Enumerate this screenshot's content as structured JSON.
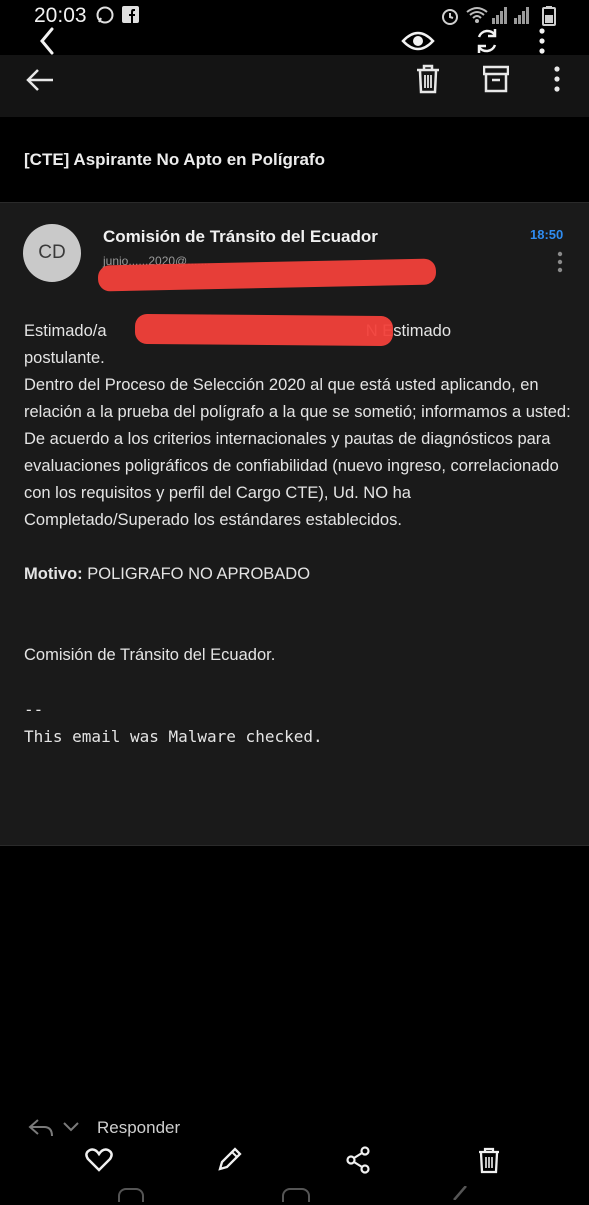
{
  "status_bar": {
    "time": "20:03",
    "icons": [
      "whatsapp-icon",
      "facebook-icon",
      "alarm-icon",
      "wifi-icon",
      "signal-icon",
      "signal-icon",
      "battery-icon"
    ]
  },
  "toolbar_overlay": {
    "icons": [
      "chevron-left-icon",
      "eye-icon",
      "sync-icon",
      "more-vertical-icon"
    ]
  },
  "app_bar": {
    "icons": [
      "arrow-back-icon",
      "trash-icon",
      "archive-icon",
      "more-vertical-icon"
    ]
  },
  "email": {
    "subject": "[CTE] Aspirante No Apto en Polígrafo",
    "avatar_initials": "CD",
    "sender_name": "Comisión de Tránsito del Ecuador",
    "sender_email": "junio......2020@.......",
    "time": "18:50",
    "greeting_prefix": "Estimado/a",
    "greeting_suffix": "N Estimado",
    "line_postulante": "postulante.",
    "para1": "Dentro del Proceso de Selección 2020 al que está usted aplicando, en relación a la prueba del polígrafo a la que se sometió; informamos a usted:",
    "para2": "De acuerdo a los criterios internacionales y pautas de diagnósticos para evaluaciones poligráficos de confiabilidad (nuevo ingreso, correlacionado con los requisitos y perfil del Cargo CTE), Ud. NO ha Completado/Superado los estándares establecidos.",
    "motivo_label": "Motivo:",
    "motivo_value": " POLIGRAFO NO APROBADO",
    "signature": "Comisión de Tránsito del Ecuador.",
    "sig_separator": "--",
    "malware_note": "This email was Malware checked."
  },
  "bottom": {
    "reply_label": "Responder",
    "actions": [
      "heart-icon",
      "pencil-icon",
      "share-icon",
      "trash-icon"
    ]
  },
  "colors": {
    "accent_time": "#2f8cf0",
    "redaction": "#f2403a",
    "card_bg": "#1a1a1a"
  }
}
